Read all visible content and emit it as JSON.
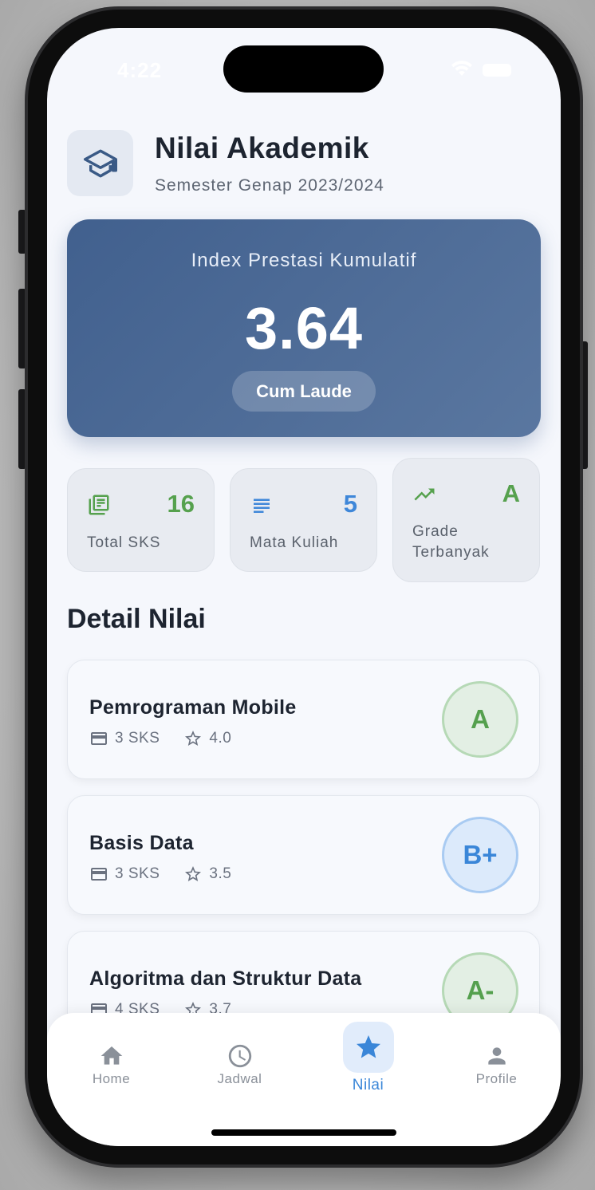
{
  "status_bar": {
    "time": "4:22"
  },
  "header": {
    "title": "Nilai Akademik",
    "subtitle": "Semester Genap 2023/2024",
    "icon": "graduation-cap-icon"
  },
  "ipk": {
    "label": "Index Prestasi Kumulatif",
    "value": "3.64",
    "badge": "Cum Laude"
  },
  "stats": [
    {
      "value": "16",
      "label": "Total SKS",
      "icon": "library-books-icon",
      "color": "#56a14e"
    },
    {
      "value": "5",
      "label": "Mata Kuliah",
      "icon": "list-icon",
      "color": "#3f87d9"
    },
    {
      "value": "A",
      "label": "Grade Terbanyak",
      "icon": "trending-up-icon",
      "color": "#56a14e"
    }
  ],
  "section_title": "Detail Nilai",
  "courses": [
    {
      "name": "Pemrograman Mobile",
      "sks": "3 SKS",
      "score": "4.0",
      "grade": "A",
      "grade_color": "#55a04e"
    },
    {
      "name": "Basis Data",
      "sks": "3 SKS",
      "score": "3.5",
      "grade": "B+",
      "grade_color": "#3a86d8"
    },
    {
      "name": "Algoritma dan Struktur Data",
      "sks": "4 SKS",
      "score": "3.7",
      "grade": "A-",
      "grade_color": "#55a04e"
    }
  ],
  "nav": [
    {
      "label": "Home",
      "icon": "home-icon"
    },
    {
      "label": "Jadwal",
      "icon": "clock-icon"
    },
    {
      "label": "Nilai",
      "icon": "star-icon",
      "active": true
    },
    {
      "label": "Profile",
      "icon": "person-icon"
    }
  ]
}
